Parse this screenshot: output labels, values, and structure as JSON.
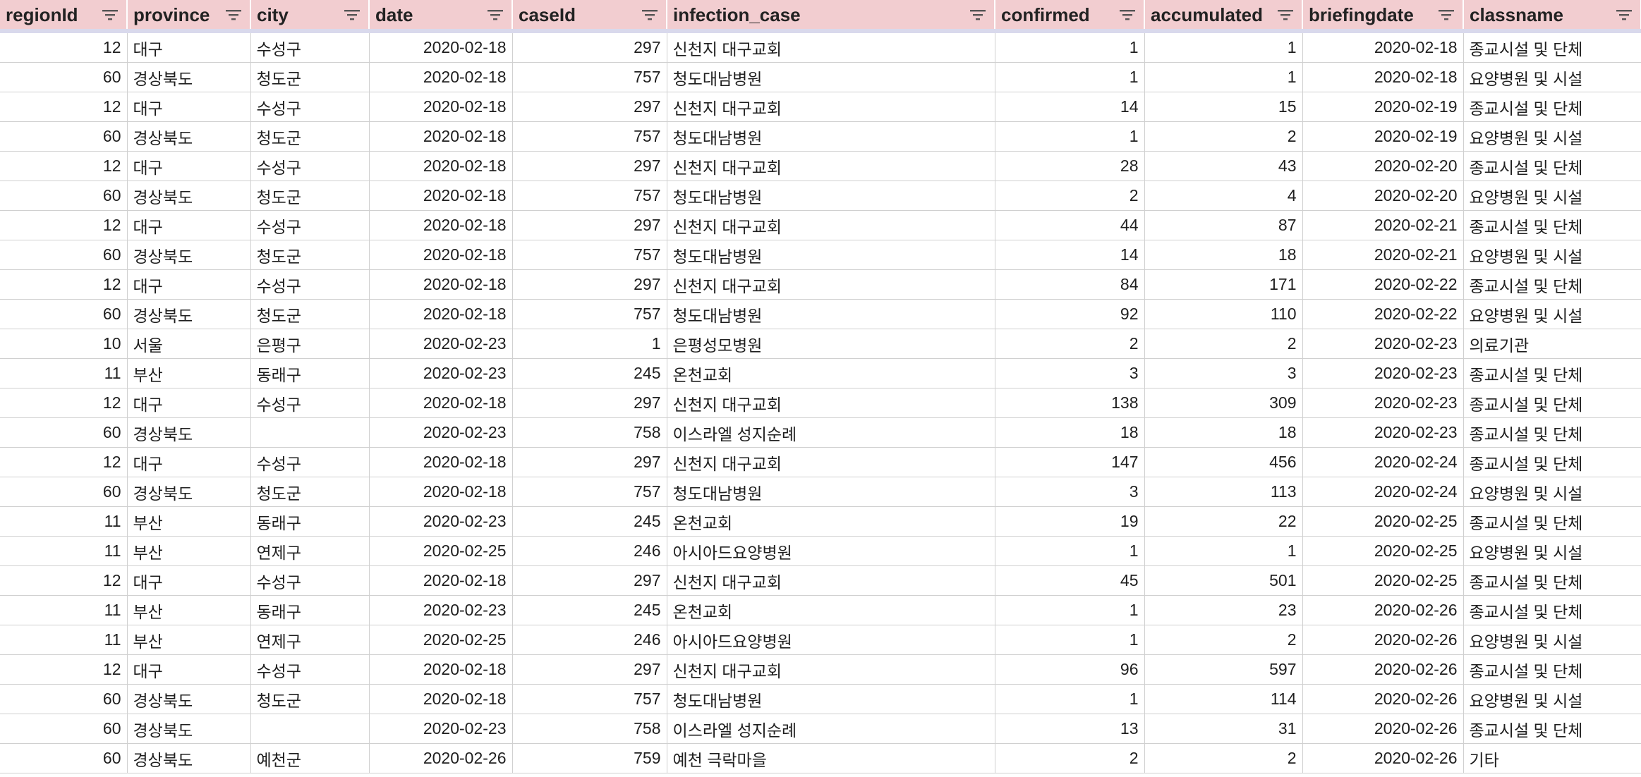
{
  "sheet": {
    "columns": [
      {
        "label": "regionId",
        "align": "num"
      },
      {
        "label": "province",
        "align": "txt"
      },
      {
        "label": "city",
        "align": "txt"
      },
      {
        "label": "date",
        "align": "num"
      },
      {
        "label": "caseId",
        "align": "num"
      },
      {
        "label": "infection_case",
        "align": "txt"
      },
      {
        "label": "confirmed",
        "align": "num"
      },
      {
        "label": "accumulated",
        "align": "num"
      },
      {
        "label": "briefingdate",
        "align": "num"
      },
      {
        "label": "classname",
        "align": "txt"
      }
    ],
    "rows": [
      [
        "12",
        "대구",
        "수성구",
        "2020-02-18",
        "297",
        "신천지 대구교회",
        "1",
        "1",
        "2020-02-18",
        "종교시설 및 단체"
      ],
      [
        "60",
        "경상북도",
        "청도군",
        "2020-02-18",
        "757",
        "청도대남병원",
        "1",
        "1",
        "2020-02-18",
        "요양병원 및 시설"
      ],
      [
        "12",
        "대구",
        "수성구",
        "2020-02-18",
        "297",
        "신천지 대구교회",
        "14",
        "15",
        "2020-02-19",
        "종교시설 및 단체"
      ],
      [
        "60",
        "경상북도",
        "청도군",
        "2020-02-18",
        "757",
        "청도대남병원",
        "1",
        "2",
        "2020-02-19",
        "요양병원 및 시설"
      ],
      [
        "12",
        "대구",
        "수성구",
        "2020-02-18",
        "297",
        "신천지 대구교회",
        "28",
        "43",
        "2020-02-20",
        "종교시설 및 단체"
      ],
      [
        "60",
        "경상북도",
        "청도군",
        "2020-02-18",
        "757",
        "청도대남병원",
        "2",
        "4",
        "2020-02-20",
        "요양병원 및 시설"
      ],
      [
        "12",
        "대구",
        "수성구",
        "2020-02-18",
        "297",
        "신천지 대구교회",
        "44",
        "87",
        "2020-02-21",
        "종교시설 및 단체"
      ],
      [
        "60",
        "경상북도",
        "청도군",
        "2020-02-18",
        "757",
        "청도대남병원",
        "14",
        "18",
        "2020-02-21",
        "요양병원 및 시설"
      ],
      [
        "12",
        "대구",
        "수성구",
        "2020-02-18",
        "297",
        "신천지 대구교회",
        "84",
        "171",
        "2020-02-22",
        "종교시설 및 단체"
      ],
      [
        "60",
        "경상북도",
        "청도군",
        "2020-02-18",
        "757",
        "청도대남병원",
        "92",
        "110",
        "2020-02-22",
        "요양병원 및 시설"
      ],
      [
        "10",
        "서울",
        "은평구",
        "2020-02-23",
        "1",
        "은평성모병원",
        "2",
        "2",
        "2020-02-23",
        "의료기관"
      ],
      [
        "11",
        "부산",
        "동래구",
        "2020-02-23",
        "245",
        "온천교회",
        "3",
        "3",
        "2020-02-23",
        "종교시설 및 단체"
      ],
      [
        "12",
        "대구",
        "수성구",
        "2020-02-18",
        "297",
        "신천지 대구교회",
        "138",
        "309",
        "2020-02-23",
        "종교시설 및 단체"
      ],
      [
        "60",
        "경상북도",
        "",
        "2020-02-23",
        "758",
        "이스라엘 성지순례",
        "18",
        "18",
        "2020-02-23",
        "종교시설 및 단체"
      ],
      [
        "12",
        "대구",
        "수성구",
        "2020-02-18",
        "297",
        "신천지 대구교회",
        "147",
        "456",
        "2020-02-24",
        "종교시설 및 단체"
      ],
      [
        "60",
        "경상북도",
        "청도군",
        "2020-02-18",
        "757",
        "청도대남병원",
        "3",
        "113",
        "2020-02-24",
        "요양병원 및 시설"
      ],
      [
        "11",
        "부산",
        "동래구",
        "2020-02-23",
        "245",
        "온천교회",
        "19",
        "22",
        "2020-02-25",
        "종교시설 및 단체"
      ],
      [
        "11",
        "부산",
        "연제구",
        "2020-02-25",
        "246",
        "아시아드요양병원",
        "1",
        "1",
        "2020-02-25",
        "요양병원 및 시설"
      ],
      [
        "12",
        "대구",
        "수성구",
        "2020-02-18",
        "297",
        "신천지 대구교회",
        "45",
        "501",
        "2020-02-25",
        "종교시설 및 단체"
      ],
      [
        "11",
        "부산",
        "동래구",
        "2020-02-23",
        "245",
        "온천교회",
        "1",
        "23",
        "2020-02-26",
        "종교시설 및 단체"
      ],
      [
        "11",
        "부산",
        "연제구",
        "2020-02-25",
        "246",
        "아시아드요양병원",
        "1",
        "2",
        "2020-02-26",
        "요양병원 및 시설"
      ],
      [
        "12",
        "대구",
        "수성구",
        "2020-02-18",
        "297",
        "신천지 대구교회",
        "96",
        "597",
        "2020-02-26",
        "종교시설 및 단체"
      ],
      [
        "60",
        "경상북도",
        "청도군",
        "2020-02-18",
        "757",
        "청도대남병원",
        "1",
        "114",
        "2020-02-26",
        "요양병원 및 시설"
      ],
      [
        "60",
        "경상북도",
        "",
        "2020-02-23",
        "758",
        "이스라엘 성지순례",
        "13",
        "31",
        "2020-02-26",
        "종교시설 및 단체"
      ],
      [
        "60",
        "경상북도",
        "예천군",
        "2020-02-26",
        "759",
        "예천 극락마을",
        "2",
        "2",
        "2020-02-26",
        "기타"
      ]
    ]
  },
  "icons": {
    "header_filter": "filter-icon"
  },
  "colors": {
    "header_bg": "#f2cdd0",
    "header_rule": "#d9d9ec",
    "grid_line": "#d0d0d0"
  }
}
